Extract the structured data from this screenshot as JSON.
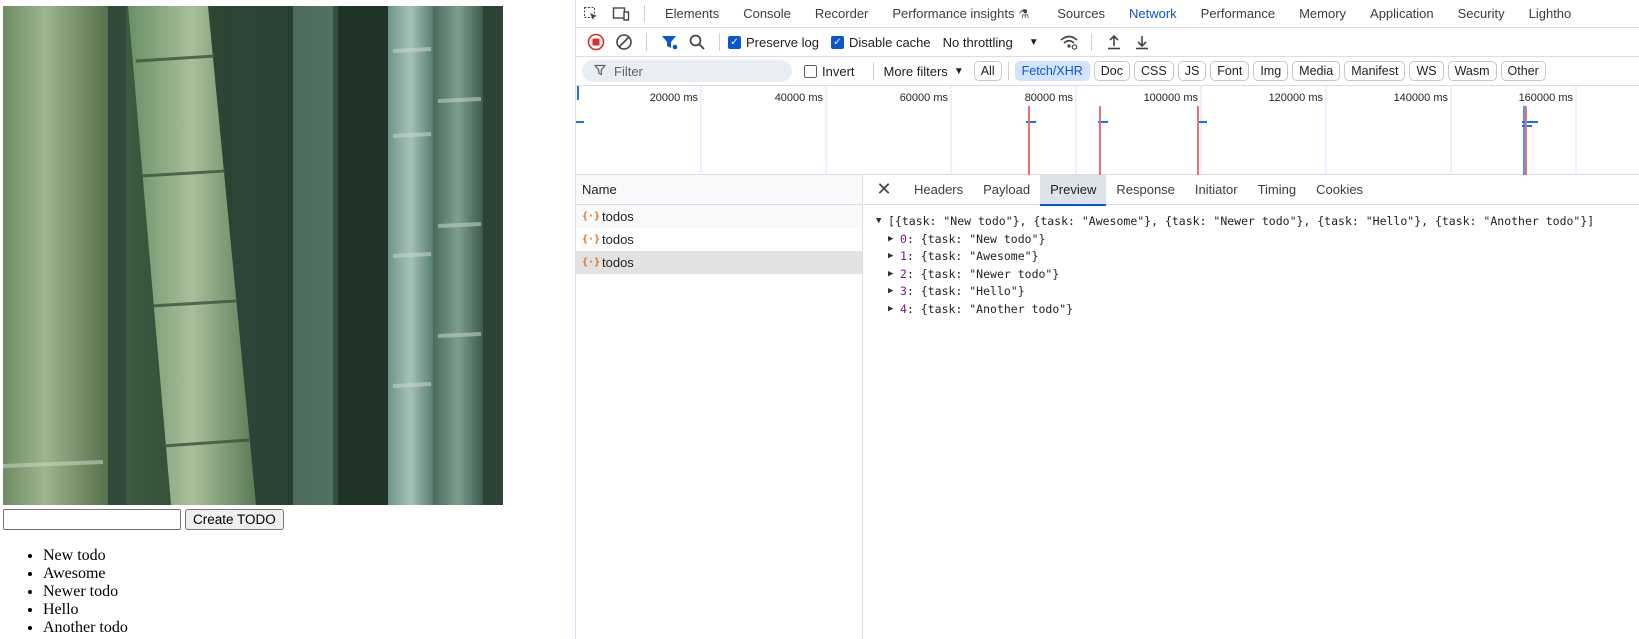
{
  "page": {
    "create_button_label": "Create TODO",
    "input_value": "",
    "todos": [
      "New todo",
      "Awesome",
      "Newer todo",
      "Hello",
      "Another todo"
    ]
  },
  "devtools": {
    "main_tabs": [
      "Elements",
      "Console",
      "Recorder",
      "Performance insights",
      "Sources",
      "Network",
      "Performance",
      "Memory",
      "Application",
      "Security",
      "Lightho"
    ],
    "active_main_tab": "Network",
    "toolbar": {
      "preserve_log_label": "Preserve log",
      "preserve_log_checked": true,
      "disable_cache_label": "Disable cache",
      "disable_cache_checked": true,
      "throttling_value": "No throttling"
    },
    "filter": {
      "placeholder": "Filter",
      "invert_label": "Invert",
      "invert_checked": false,
      "more_filters_label": "More filters",
      "chips": [
        "All",
        "Fetch/XHR",
        "Doc",
        "CSS",
        "JS",
        "Font",
        "Img",
        "Media",
        "Manifest",
        "WS",
        "Wasm",
        "Other"
      ],
      "active_chip": "Fetch/XHR"
    },
    "timeline": {
      "tick_labels": [
        "20000 ms",
        "40000 ms",
        "60000 ms",
        "80000 ms",
        "100000 ms",
        "120000 ms",
        "140000 ms",
        "160000 ms"
      ]
    },
    "requests": {
      "header": "Name",
      "rows": [
        "todos",
        "todos",
        "todos"
      ],
      "selected_index": 2
    },
    "detail": {
      "tabs": [
        "Headers",
        "Payload",
        "Preview",
        "Response",
        "Initiator",
        "Timing",
        "Cookies"
      ],
      "active_tab": "Preview",
      "preview_root": "[{task: \"New todo\"}, {task: \"Awesome\"}, {task: \"Newer todo\"}, {task: \"Hello\"}, {task: \"Another todo\"}]",
      "preview_items": [
        {
          "index": "0",
          "value": "{task: \"New todo\"}"
        },
        {
          "index": "1",
          "value": "{task: \"Awesome\"}"
        },
        {
          "index": "2",
          "value": "{task: \"Newer todo\"}"
        },
        {
          "index": "3",
          "value": "{task: \"Hello\"}"
        },
        {
          "index": "4",
          "value": "{task: \"Another todo\"}"
        }
      ]
    },
    "colors": {
      "accent": "#0b57d0",
      "record_red": "#d93025",
      "xhr_orange": "#e8710a"
    }
  }
}
